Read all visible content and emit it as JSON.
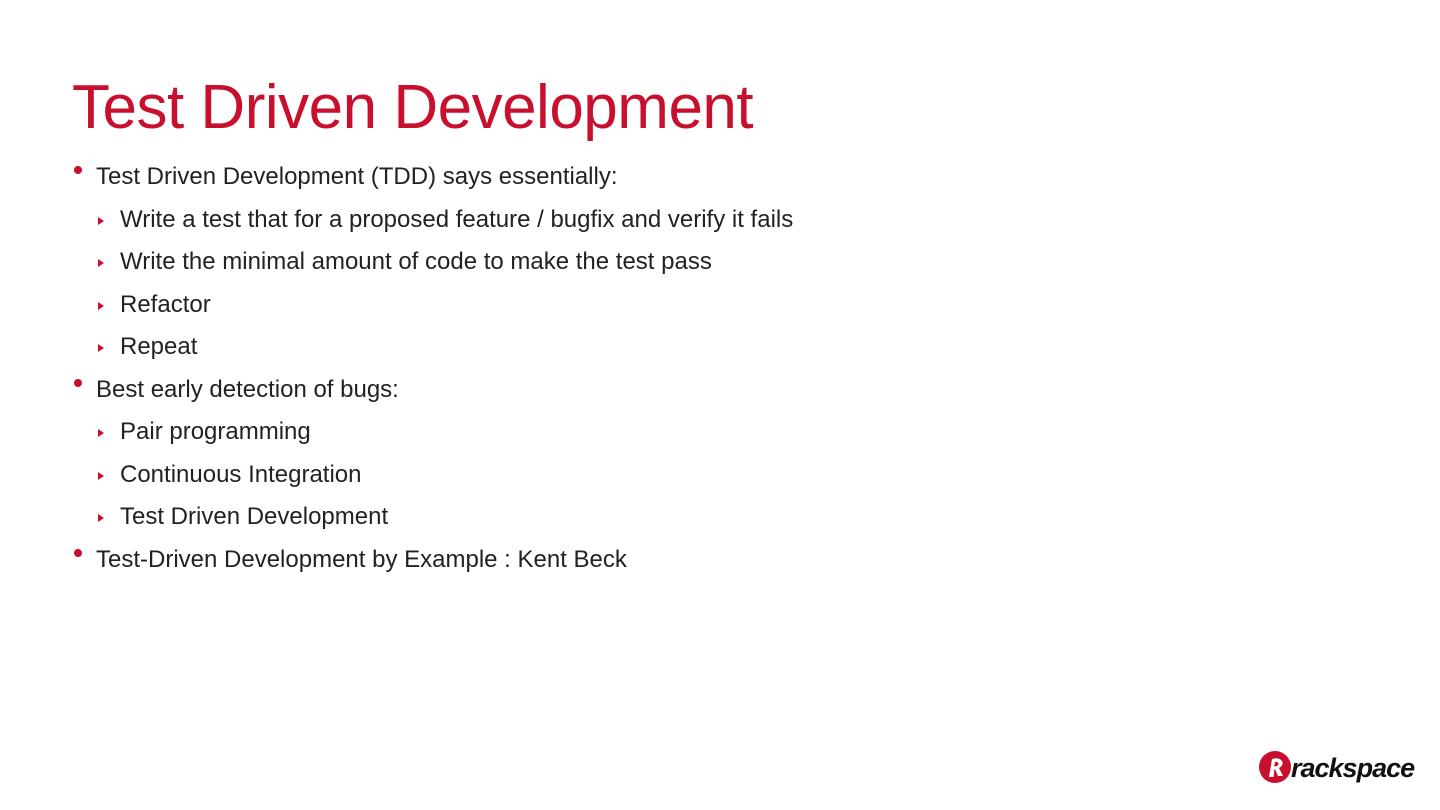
{
  "slide": {
    "title": "Test Driven Development",
    "accent_color": "#c8102e",
    "text_color": "#222222",
    "bullets": [
      {
        "level": 1,
        "text": "Test Driven Development (TDD) says essentially:"
      },
      {
        "level": 2,
        "text": "Write a test that for a proposed feature / bugfix and verify it fails"
      },
      {
        "level": 2,
        "text": "Write the minimal amount of code to make the test pass"
      },
      {
        "level": 2,
        "text": "Refactor"
      },
      {
        "level": 2,
        "text": "Repeat"
      },
      {
        "level": 1,
        "text": "Best early detection of bugs:"
      },
      {
        "level": 2,
        "text": "Pair programming"
      },
      {
        "level": 2,
        "text": "Continuous Integration"
      },
      {
        "level": 2,
        "text": "Test Driven Development"
      },
      {
        "level": 1,
        "text": "Test-Driven Development by Example : Kent Beck"
      }
    ]
  },
  "logo": {
    "wordmark": "rackspace",
    "icon": "rackspace-logo-icon"
  }
}
